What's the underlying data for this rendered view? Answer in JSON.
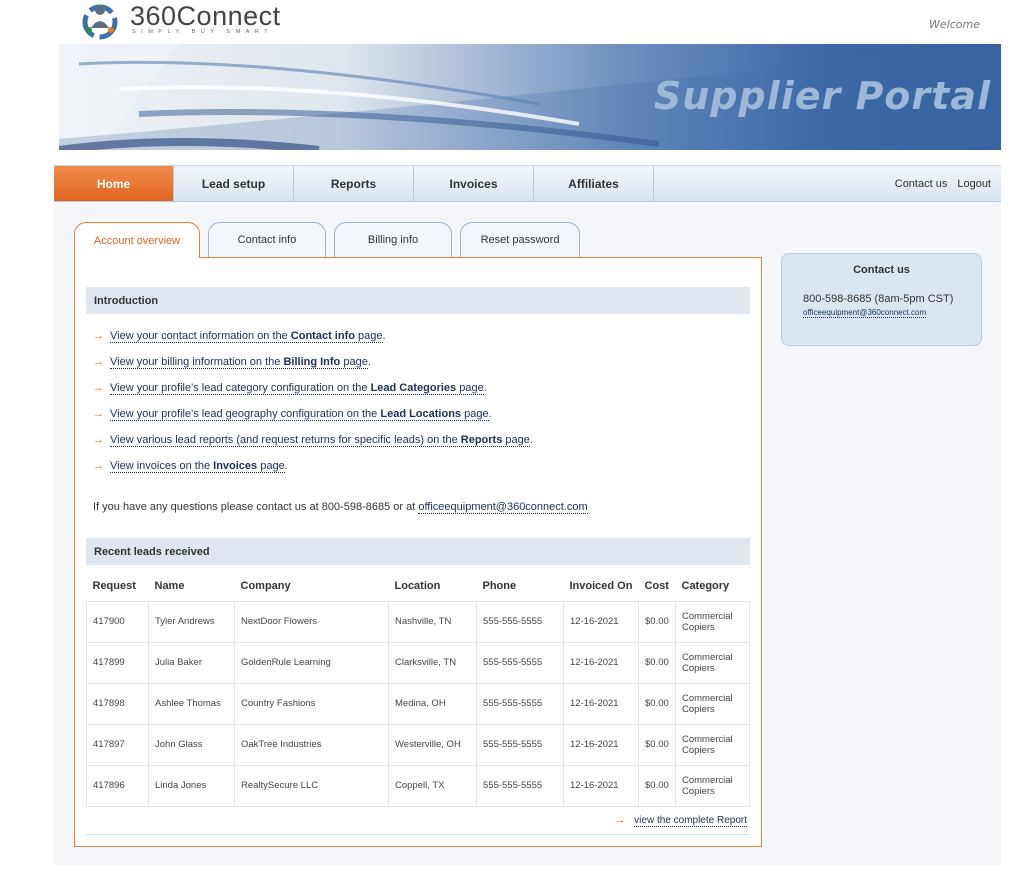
{
  "header": {
    "logo_name": "360Connect",
    "logo_tagline": "SIMPLY BUY SMART",
    "welcome": "Welcome"
  },
  "banner": {
    "title": "Supplier Portal"
  },
  "nav": {
    "items": [
      {
        "label": "Home",
        "active": true
      },
      {
        "label": "Lead setup",
        "active": false
      },
      {
        "label": "Reports",
        "active": false
      },
      {
        "label": "Invoices",
        "active": false
      },
      {
        "label": "Affiliates",
        "active": false
      }
    ],
    "contact_us": "Contact us",
    "logout": "Logout"
  },
  "tabs": [
    {
      "label": "Account overview",
      "active": true
    },
    {
      "label": "Contact info",
      "active": false
    },
    {
      "label": "Billing info",
      "active": false
    },
    {
      "label": "Reset password",
      "active": false
    }
  ],
  "intro": {
    "heading": "Introduction",
    "items": [
      {
        "pre": "View your contact information on the ",
        "bold": "Contact info",
        "post": " page"
      },
      {
        "pre": "View your billing information on the ",
        "bold": "Billing Info",
        "post": " page"
      },
      {
        "pre": "View your profile's lead category configuration on the ",
        "bold": "Lead Categories",
        "post": " page"
      },
      {
        "pre": "View your profile's lead geography configuration on the ",
        "bold": "Lead Locations",
        "post": " page"
      },
      {
        "pre": "View various lead reports (and request returns for specific leads) on the ",
        "bold": "Reports",
        "post": " page"
      },
      {
        "pre": "View invoices on the ",
        "bold": "Invoices",
        "post": " page"
      }
    ],
    "question_text": "If you have any questions please contact us at 800-598-8685 or at ",
    "question_email": "officeequipment@360connect.com"
  },
  "leads": {
    "heading": "Recent leads received",
    "columns": [
      "Request",
      "Name",
      "Company",
      "Location",
      "Phone",
      "Invoiced On",
      "Cost",
      "Category"
    ],
    "rows": [
      [
        "417900",
        "Tyler Andrews",
        "NextDoor Flowers",
        "Nashville, TN",
        "555-555-5555",
        "12-16-2021",
        "$0.00",
        "Commercial Copiers"
      ],
      [
        "417899",
        "Julia Baker",
        "GoldenRule Learning",
        "Clarksville, TN",
        "555-555-5555",
        "12-16-2021",
        "$0.00",
        "Commercial Copiers"
      ],
      [
        "417898",
        "Ashlee Thomas",
        "Country Fashions",
        "Medina, OH",
        "555-555-5555",
        "12-16-2021",
        "$0.00",
        "Commercial Copiers"
      ],
      [
        "417897",
        "John Glass",
        "OakTree Industries",
        "Westerville, OH",
        "555-555-5555",
        "12-16-2021",
        "$0.00",
        "Commercial Copiers"
      ],
      [
        "417896",
        "Linda Jones",
        "RealtySecure LLC",
        "Coppell, TX",
        "555-555-5555",
        "12-16-2021",
        "$0.00",
        "Commercial Copiers"
      ]
    ],
    "view_report": "view the complete Report"
  },
  "contact_box": {
    "title": "Contact us",
    "phone": "800-598-8685 (8am-5pm CST)",
    "email": "officeequipment@360connect.com"
  },
  "colors": {
    "accent_orange": "#e0641f",
    "nav_blue": "#d9e4f1",
    "link": "#1c2e5a",
    "banner_blue": "#36609f"
  },
  "icons": {
    "logo": "people-circle-logo-icon",
    "arrow": "right-arrow-icon"
  }
}
